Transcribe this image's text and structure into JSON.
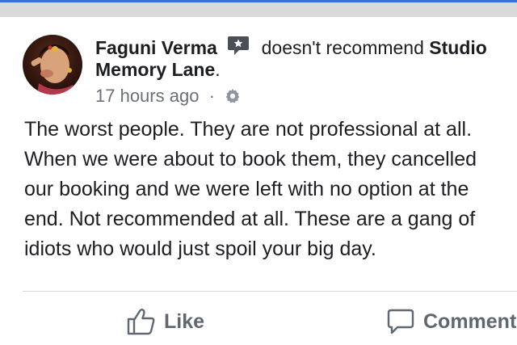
{
  "post": {
    "author": "Faguni Verma",
    "verb": "doesn't recommend",
    "page_name_part1": "Studio",
    "page_name_part2": "Memory Lane",
    "page_name_end": ".",
    "time": "17 hours ago",
    "separator": "·",
    "lines": [
      "The worst people. They are not professional at all.",
      "When we were about to book them, they cancelled",
      "our booking and we were left with no option at the",
      "end. Not recommended at all. These are a gang of",
      "idiots who would just spoil your big day."
    ]
  },
  "actions": {
    "like_label": "Like",
    "comment_label": "Comment"
  },
  "colors": {
    "top_bar_blue": "#3b6fd8",
    "band_gray": "#d9d9db",
    "text": "#1c1e21",
    "meta": "#6b6f76",
    "action": "#606770"
  },
  "icons": {
    "recommend": "speech-bubble-star-icon",
    "privacy": "gear-icon",
    "like": "thumbs-up-icon",
    "comment": "comment-bubble-icon"
  }
}
